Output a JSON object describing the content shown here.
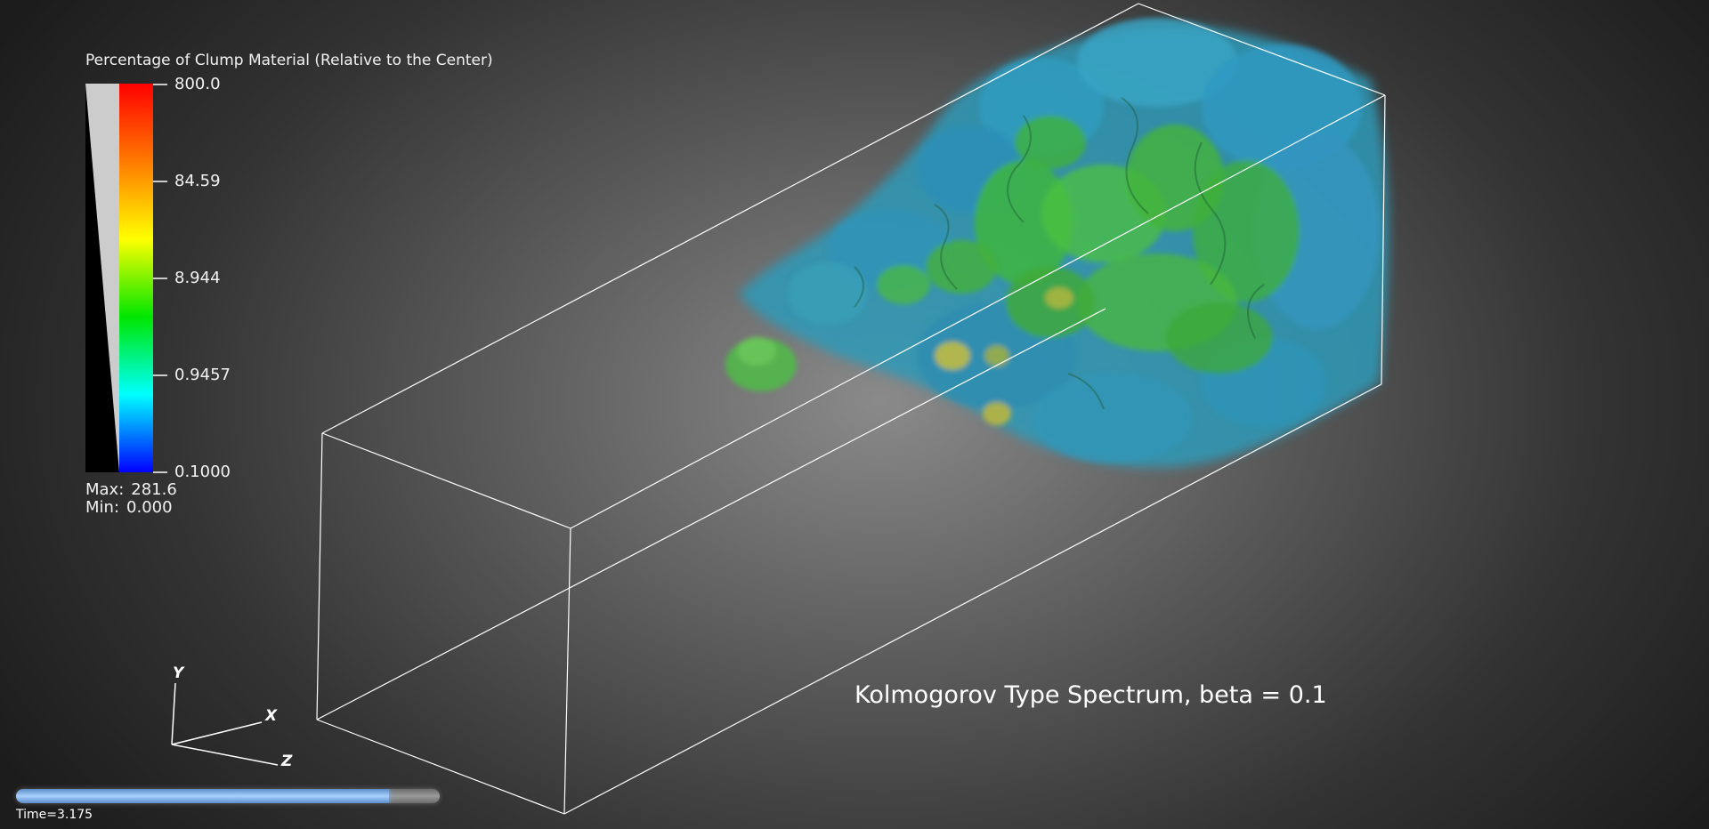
{
  "legend": {
    "title": "Percentage of Clump Material (Relative to the Center)",
    "ticks": [
      "800.0",
      "84.59",
      "8.944",
      "0.9457",
      "0.1000"
    ],
    "max_label": "Max:",
    "max_value": "281.6",
    "min_label": "Min:",
    "min_value": "0.000",
    "colors": [
      "#ff0000",
      "#ff7a00",
      "#ffff00",
      "#00e600",
      "#00ffff",
      "#0000ff"
    ]
  },
  "axes": {
    "x": "X",
    "y": "Y",
    "z": "Z"
  },
  "annotation": "Kolmogorov Type Spectrum, beta = 0.1",
  "time": {
    "label": "Time=3.175",
    "progress": 0.88
  },
  "volume_colors": {
    "blue": "#2a8fc4",
    "green": "#35b030",
    "yellow": "#c7c23a"
  }
}
